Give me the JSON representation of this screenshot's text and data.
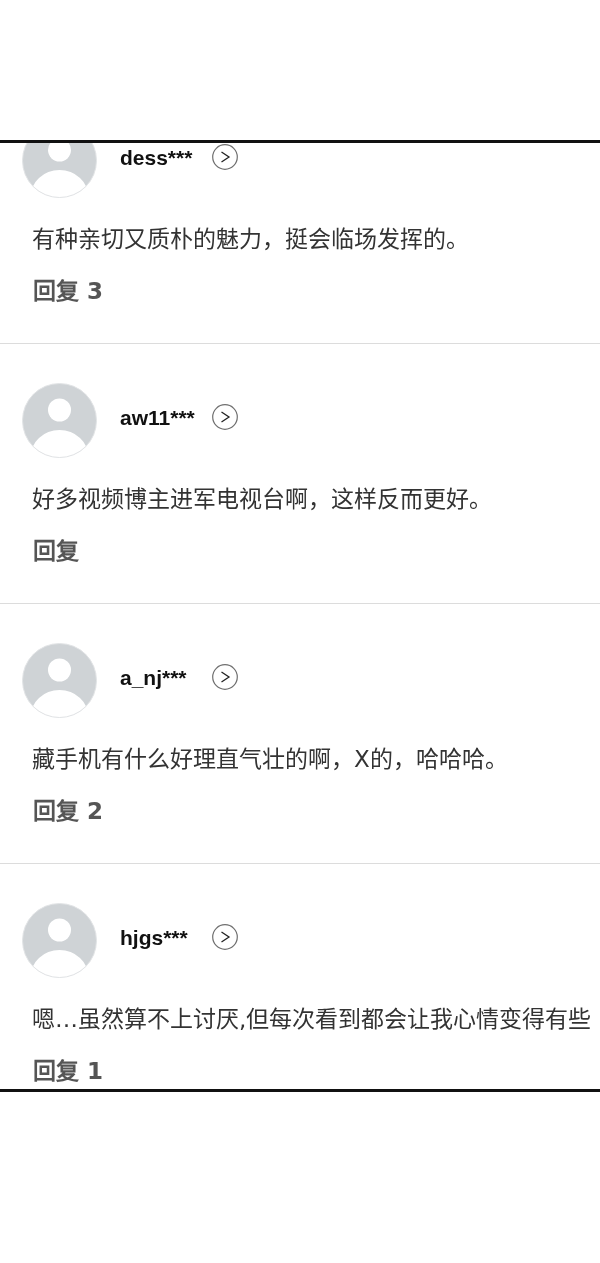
{
  "comments": [
    {
      "username": "dess***",
      "text": "有种亲切又质朴的魅力，挺会临场发挥的。",
      "reply": "回复 3"
    },
    {
      "username": "aw11***",
      "text": "好多视频博主进军电视台啊，这样反而更好。",
      "reply": "回复"
    },
    {
      "username": "a_nj***",
      "text": "藏手机有什么好理直气壮的啊，X的，哈哈哈。",
      "reply": "回复 2"
    },
    {
      "username": "hjgs***",
      "text": "嗯…虽然算不上讨厌,但每次看到都会让我心情变得有些",
      "reply": "回复 1"
    }
  ]
}
